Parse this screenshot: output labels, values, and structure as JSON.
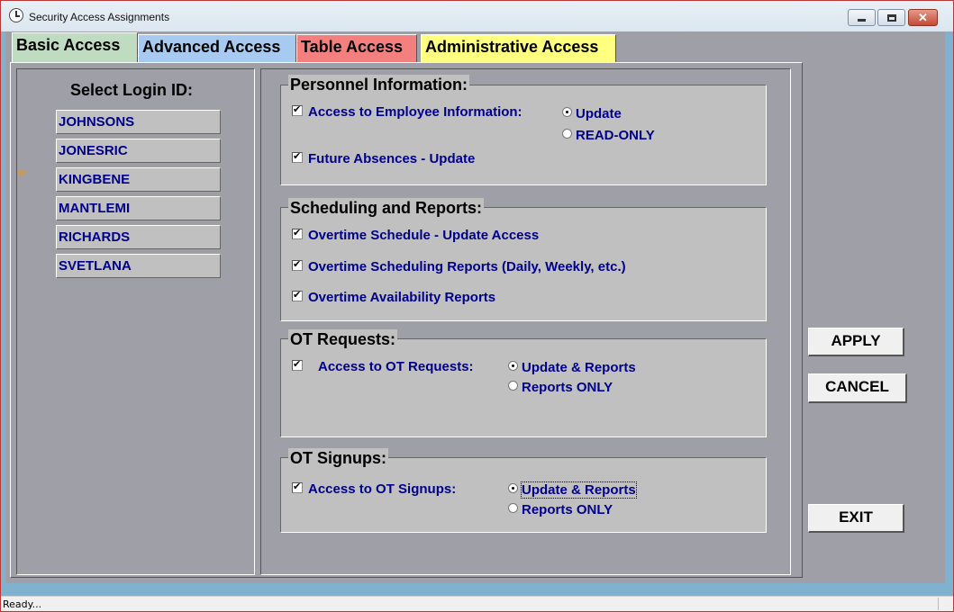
{
  "window": {
    "title": "Security Access Assignments",
    "close_glyph": "✕"
  },
  "tabs": [
    {
      "label": "Basic Access",
      "color": "#c0dcc0",
      "selected": true
    },
    {
      "label": "Advanced Access",
      "color": "#a6caf0"
    },
    {
      "label": "Table Access",
      "color": "#f47f7f"
    },
    {
      "label": "Administrative Access",
      "color": "#ffff80"
    }
  ],
  "login": {
    "title": "Select Login ID:",
    "items": [
      "JOHNSONS",
      "JONESRIC",
      "KINGBENE",
      "MANTLEMI",
      "RICHARDS",
      "SVETLANA"
    ],
    "selected": "KINGBENE",
    "pointer_icon": "pointing-hand-icon"
  },
  "personnel": {
    "title": "Personnel Information:",
    "employee_info": {
      "label": "Access to Employee Information:",
      "checked": true
    },
    "options": [
      {
        "label": "Update",
        "selected": true
      },
      {
        "label": "READ-ONLY",
        "selected": false
      }
    ],
    "future_absences": {
      "label": "Future Absences - Update",
      "checked": true
    }
  },
  "scheduling": {
    "title": "Scheduling and Reports:",
    "items": [
      {
        "label": "Overtime Schedule - Update Access",
        "checked": true
      },
      {
        "label": "Overtime Scheduling Reports (Daily, Weekly, etc.)",
        "checked": true
      },
      {
        "label": "Overtime Availability Reports",
        "checked": true
      }
    ]
  },
  "ot_requests": {
    "title": "OT Requests:",
    "access": {
      "label": "Access to OT Requests:",
      "checked": true
    },
    "options": [
      {
        "label": "Update & Reports",
        "selected": true
      },
      {
        "label": "Reports ONLY",
        "selected": false
      }
    ]
  },
  "ot_signups": {
    "title": "OT Signups:",
    "access": {
      "label": "Access to OT Signups:",
      "checked": true
    },
    "options": [
      {
        "label": "Update & Reports",
        "selected": true
      },
      {
        "label": "Reports ONLY",
        "selected": false
      }
    ]
  },
  "buttons": {
    "apply": "APPLY",
    "cancel": "CANCEL",
    "exit": "EXIT"
  },
  "status": {
    "text": "Ready..."
  }
}
